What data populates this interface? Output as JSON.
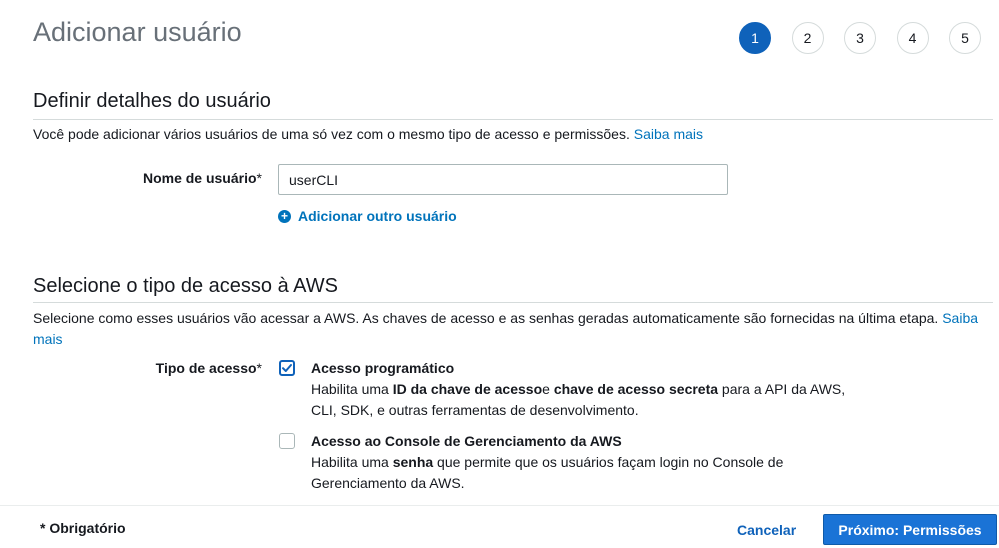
{
  "page": {
    "title": "Adicionar usuário"
  },
  "steps": [
    "1",
    "2",
    "3",
    "4",
    "5"
  ],
  "details": {
    "title": "Definir detalhes do usuário",
    "description": "Você pode adicionar vários usuários de uma só vez com o mesmo tipo de acesso e permissões.",
    "learn_more": "Saiba mais",
    "username_label": "Nome de usuário",
    "required_mark": "*",
    "username_value": "userCLI",
    "add_another": "Adicionar outro usuário"
  },
  "access": {
    "title": "Selecione o tipo de acesso à AWS",
    "description": "Selecione como esses usuários vão acessar a AWS. As chaves de acesso e as senhas geradas automaticamente são fornecidas na última etapa.",
    "learn_more_line1": "Saiba",
    "learn_more_line2": "mais",
    "type_label": "Tipo de acesso",
    "required_mark": "*",
    "options": [
      {
        "title": "Acesso programático",
        "checked": true,
        "desc_1": "Habilita uma ",
        "desc_bold_1": "ID da chave de acesso",
        "desc_2": "e ",
        "desc_bold_2": "chave de acesso secreta",
        "desc_3": " para a API da AWS,",
        "desc_line2": "CLI, SDK, e outras ferramentas de desenvolvimento."
      },
      {
        "title": "Acesso ao Console de Gerenciamento da AWS",
        "checked": false,
        "desc_1": "Habilita uma ",
        "desc_bold_1": "senha",
        "desc_2": " que permite que os usuários façam login no Console de",
        "desc_line2": "Gerenciamento da AWS."
      }
    ]
  },
  "footer": {
    "required_note": "* Obrigatório",
    "cancel": "Cancelar",
    "next": "Próximo: Permissões"
  },
  "colors": {
    "accent": "#0f62ba",
    "link": "#0073bb",
    "title_gray": "#687078"
  }
}
